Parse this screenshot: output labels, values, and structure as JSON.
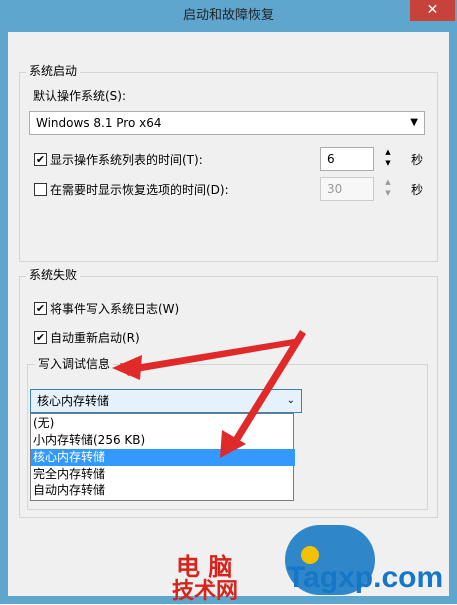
{
  "window": {
    "title": "启动和故障恢复",
    "close_glyph": "✕"
  },
  "startup": {
    "legend": "系统启动",
    "default_os_label": "默认操作系统(S):",
    "default_os_value": "Windows 8.1 Pro x64",
    "show_os_list": {
      "checked": true,
      "label": "显示操作系统列表的时间(T):",
      "value": "6",
      "unit": "秒"
    },
    "show_recovery": {
      "checked": false,
      "label": "在需要时显示恢复选项的时间(D):",
      "value": "30",
      "unit": "秒"
    }
  },
  "failure": {
    "legend": "系统失败",
    "write_event": {
      "checked": true,
      "label": "将事件写入系统日志(W)"
    },
    "auto_restart": {
      "checked": true,
      "label": "自动重新启动(R)"
    },
    "debug": {
      "legend": "写入调试信息",
      "selected": "核心内存转储",
      "options": [
        "(无)",
        "小内存转储(256 KB)",
        "核心内存转储",
        "完全内存转储",
        "自动内存转储"
      ],
      "highlighted_index": 2
    }
  },
  "watermark": {
    "line1": "电 脑",
    "line2": "技术网",
    "site": "Tagxp.com"
  },
  "colors": {
    "frame": "#5fa6cf",
    "arrow": "#e02a2a",
    "highlight": "#3399ff",
    "watermark_red": "#d8231a",
    "watermark_blue": "#1677c8"
  }
}
